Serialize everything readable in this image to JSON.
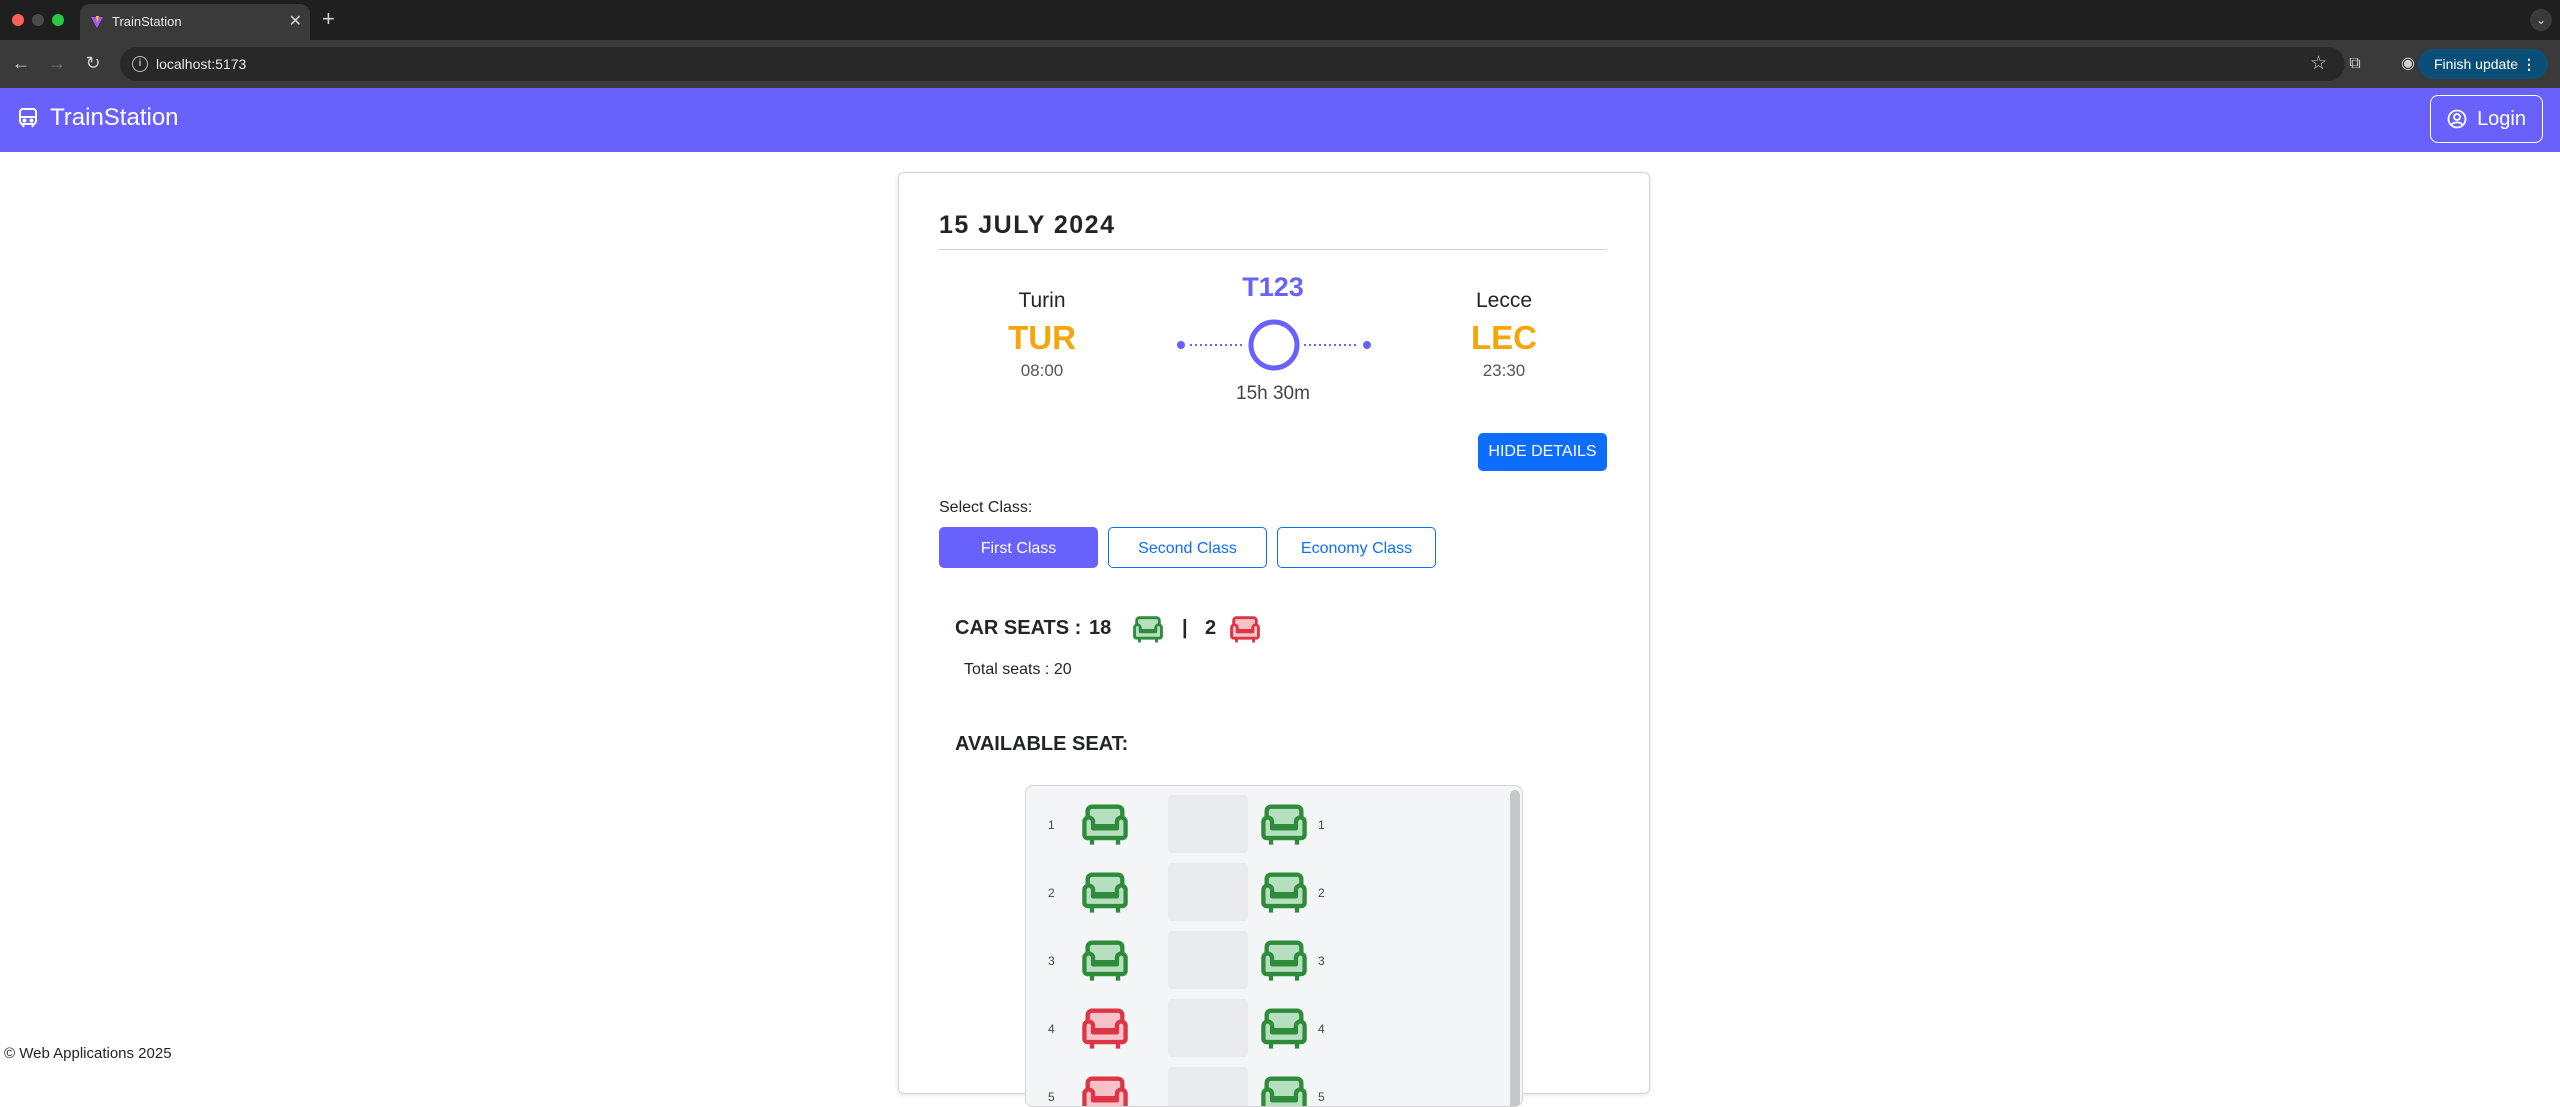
{
  "browser": {
    "tab_title": "TrainStation",
    "url": "localhost:5173",
    "update_button": "Finish update"
  },
  "app": {
    "brand": "TrainStation",
    "login_label": "Login",
    "footer": "© Web Applications 2025"
  },
  "trip": {
    "date": "15 JULY 2024",
    "origin": {
      "city": "Turin",
      "code": "TUR",
      "time": "08:00"
    },
    "destination": {
      "city": "Lecce",
      "code": "LEC",
      "time": "23:30"
    },
    "train_code": "T123",
    "duration": "15h 30m",
    "hide_details_label": "HIDE DETAILS"
  },
  "classes": {
    "label": "Select Class:",
    "options": [
      "First Class",
      "Second Class",
      "Economy Class"
    ],
    "selected": "First Class"
  },
  "seats": {
    "car_seats_label": "CAR SEATS :",
    "available_count": "18",
    "separator": "|",
    "occupied_count": "2",
    "total_label": "Total seats : 20",
    "available_title": "AVAILABLE SEAT:",
    "rows": [
      {
        "num": "1",
        "left": "available",
        "right": "available"
      },
      {
        "num": "2",
        "left": "available",
        "right": "available"
      },
      {
        "num": "3",
        "left": "available",
        "right": "available"
      },
      {
        "num": "4",
        "left": "occupied",
        "right": "available"
      },
      {
        "num": "5",
        "left": "occupied",
        "right": "available"
      }
    ]
  },
  "colors": {
    "brand": "#6861fc",
    "accent_code": "#f6a50b",
    "seat_available": "#2e8b3a",
    "seat_occupied": "#dc3545",
    "primary": "#0d6efd"
  }
}
